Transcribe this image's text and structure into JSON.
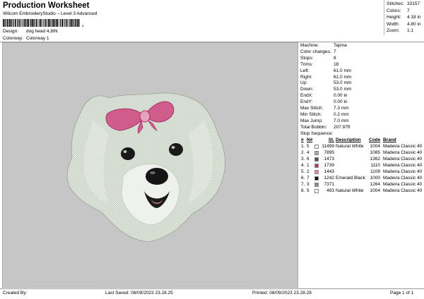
{
  "header": {
    "title": "Production Worksheet",
    "software": "Wilcom EmbroideryStudio – Level 3 Advanced",
    "barcode_suffix": ",",
    "design_label": "Design:",
    "design_value": "dog head 4,8IN",
    "colorway_label": "Colorway:",
    "colorway_value": "Colorway 1"
  },
  "stats": [
    {
      "label": "Stitches:",
      "value": "33157"
    },
    {
      "label": "Colors:",
      "value": "7"
    },
    {
      "label": "Height:",
      "value": "4.18 in"
    },
    {
      "label": "Width:",
      "value": "4.80 in"
    },
    {
      "label": "Zoom:",
      "value": "1:1"
    }
  ],
  "info": [
    {
      "label": "Machine:",
      "value": "Tajima"
    },
    {
      "label": "Color changes:",
      "value": "7"
    },
    {
      "label": "Stops:",
      "value": "8"
    },
    {
      "label": "Trims:",
      "value": "18"
    },
    {
      "label": "Left:",
      "value": "61.0 mm"
    },
    {
      "label": "Right:",
      "value": "61.0 mm"
    },
    {
      "label": "Up:",
      "value": "53.0 mm"
    },
    {
      "label": "Down:",
      "value": "53.0 mm"
    },
    {
      "label": "EndX:",
      "value": "0.00 in"
    },
    {
      "label": "EndY:",
      "value": "0.00 in"
    },
    {
      "label": "Max Stitch:",
      "value": "7.3 mm"
    },
    {
      "label": "Min Stitch:",
      "value": "0.2 mm"
    },
    {
      "label": "Max Jump:",
      "value": "7.0 mm"
    },
    {
      "label": "Total Bobbin:",
      "value": "207.97ft"
    }
  ],
  "stop_sequence": {
    "title": "Stop Sequence:",
    "headers": {
      "num": "#",
      "n": "N#",
      "st": "St.",
      "desc": "Description",
      "code": "Code",
      "brand": "Brand"
    },
    "rows": [
      {
        "num": "1.",
        "n": "5",
        "color": "#f4f4f4",
        "st": "11499",
        "desc": "Natural White",
        "code": "1004",
        "brand": "Madeira Classic 40"
      },
      {
        "num": "2.",
        "n": "4",
        "color": "#a8a8a8",
        "st": "7895",
        "desc": "",
        "code": "1085",
        "brand": "Madeira Classic 40"
      },
      {
        "num": "3.",
        "n": "6",
        "color": "#4d4d4d",
        "st": "1473",
        "desc": "",
        "code": "1362",
        "brand": "Madeira Classic 40"
      },
      {
        "num": "4.",
        "n": "1",
        "color": "#c0306f",
        "st": "1739",
        "desc": "",
        "code": "1110",
        "brand": "Madeira Classic 40"
      },
      {
        "num": "5.",
        "n": "2",
        "color": "#e58aa8",
        "st": "1443",
        "desc": "",
        "code": "1108",
        "brand": "Madeira Classic 40"
      },
      {
        "num": "6.",
        "n": "7",
        "color": "#111111",
        "st": "1242",
        "desc": "Emerald Black",
        "code": "1000",
        "brand": "Madeira Classic 40"
      },
      {
        "num": "7.",
        "n": "3",
        "color": "#8c8c8c",
        "st": "7371",
        "desc": "",
        "code": "1264",
        "brand": "Madeira Classic 40"
      },
      {
        "num": "8.",
        "n": "5",
        "color": "#f4f4f4",
        "st": "493",
        "desc": "Natural White",
        "code": "1004",
        "brand": "Madeira Classic 40"
      }
    ]
  },
  "footer": {
    "created_by": "Created By:",
    "last_saved": "Last Saved: 08/09/2023 23.28.25",
    "printed": "Printed: 08/09/2023 23.28.28",
    "page": "Page 1 of 1"
  },
  "colors": {
    "canvas_bg": "#c6c6c6",
    "fur": "#dfe6dc",
    "bow": "#d05c8c"
  }
}
